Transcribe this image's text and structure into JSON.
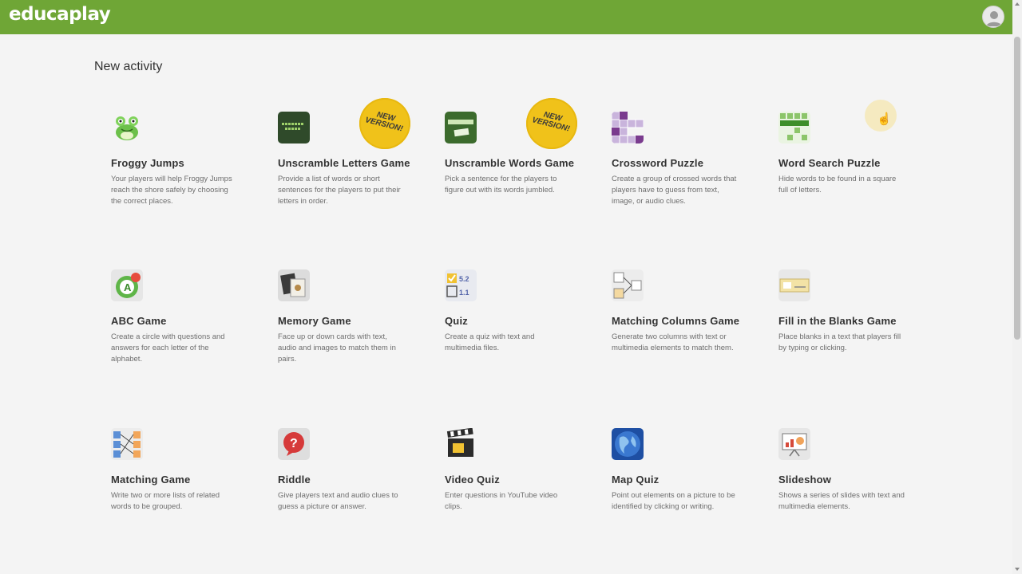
{
  "header": {
    "logo": "educaplay",
    "avatar_icon": "user-avatar-icon",
    "bar_color": "#6fa636"
  },
  "page": {
    "title": "New activity"
  },
  "badge_text": "NEW VERSION!",
  "activities": [
    {
      "name": "Froggy Jumps",
      "desc": "Your players will help Froggy Jumps reach the shore safely by choosing the correct places.",
      "icon": "frog-icon"
    },
    {
      "name": "Unscramble Letters Game",
      "desc": "Provide a list of words or short sentences for the players to put their letters in order.",
      "icon": "unscramble-letters-icon",
      "badge": true
    },
    {
      "name": "Unscramble Words Game",
      "desc": "Pick a sentence for the players to figure out with its words jumbled.",
      "icon": "unscramble-words-icon",
      "badge": true
    },
    {
      "name": "Crossword Puzzle",
      "desc": "Create a group of crossed words that players have to guess from text, image, or audio clues.",
      "icon": "crossword-icon"
    },
    {
      "name": "Word Search Puzzle",
      "desc": "Hide words to be found in a square full of letters.",
      "icon": "word-search-icon"
    },
    {
      "name": "ABC Game",
      "desc": "Create a circle with questions and answers for each letter of the alphabet.",
      "icon": "abc-icon"
    },
    {
      "name": "Memory Game",
      "desc": "Face up or down cards with text, audio and images to match them in pairs.",
      "icon": "memory-cards-icon"
    },
    {
      "name": "Quiz",
      "desc": "Create a quiz with text and multimedia files.",
      "icon": "quiz-icon"
    },
    {
      "name": "Matching Columns Game",
      "desc": "Generate two columns with text or multimedia elements to match them.",
      "icon": "matching-columns-icon"
    },
    {
      "name": "Fill in the Blanks Game",
      "desc": "Place blanks in a text that players fill by typing or clicking.",
      "icon": "fill-blanks-icon"
    },
    {
      "name": "Matching Game",
      "desc": "Write two or more lists of related words to be grouped.",
      "icon": "matching-icon"
    },
    {
      "name": "Riddle",
      "desc": "Give players text and audio clues to guess a picture or answer.",
      "icon": "riddle-icon"
    },
    {
      "name": "Video Quiz",
      "desc": "Enter questions in YouTube video clips.",
      "icon": "clapperboard-icon"
    },
    {
      "name": "Map Quiz",
      "desc": "Point out elements on a picture to be identified by clicking or writing.",
      "icon": "globe-icon"
    },
    {
      "name": "Slideshow",
      "desc": "Shows a series of slides with text and multimedia elements.",
      "icon": "slideshow-icon"
    }
  ]
}
